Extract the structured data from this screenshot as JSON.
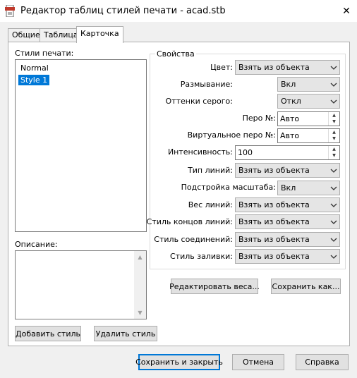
{
  "window": {
    "title": "Редактор таблиц стилей печати - acad.stb",
    "close_glyph": "✕"
  },
  "tabs": [
    {
      "label": "Общие"
    },
    {
      "label": "Таблица"
    },
    {
      "label": "Карточка",
      "active": true
    }
  ],
  "styles": {
    "label": "Стили печати:",
    "items": [
      {
        "label": "Normal",
        "selected": false
      },
      {
        "label": "Style 1",
        "selected": true
      }
    ]
  },
  "description": {
    "label": "Описание:",
    "value": ""
  },
  "buttons": {
    "add_style": "Добавить стиль",
    "delete_style": "Удалить стиль",
    "edit_weights": "Редактировать веса...",
    "save_as": "Сохранить как...",
    "save_close": "Сохранить и закрыть",
    "cancel": "Отмена",
    "help": "Справка"
  },
  "properties": {
    "title": "Свойства",
    "color": {
      "label": "Цвет:",
      "value": "Взять из объекта"
    },
    "dithering": {
      "label": "Размывание:",
      "value": "Вкл"
    },
    "grayscale": {
      "label": "Оттенки серого:",
      "value": "Откл"
    },
    "pen": {
      "label": "Перо №:",
      "value": "Авто"
    },
    "virtual_pen": {
      "label": "Виртуальное перо №:",
      "value": "Авто"
    },
    "intensity": {
      "label": "Интенсивность:",
      "value": "100"
    },
    "linetype": {
      "label": "Тип линий:",
      "value": "Взять из объекта"
    },
    "adaptive": {
      "label": "Подстройка масштаба:",
      "value": "Вкл"
    },
    "lineweight": {
      "label": "Вес линий:",
      "value": "Взять из объекта"
    },
    "line_end": {
      "label": "Стиль концов линий:",
      "value": "Взять из объекта"
    },
    "line_join": {
      "label": "Стиль соединений:",
      "value": "Взять из объекта"
    },
    "fill_style": {
      "label": "Стиль заливки:",
      "value": "Взять из объекта"
    }
  },
  "colors": {
    "selection": "#0078d7",
    "default_button_border": "#0078d7"
  }
}
